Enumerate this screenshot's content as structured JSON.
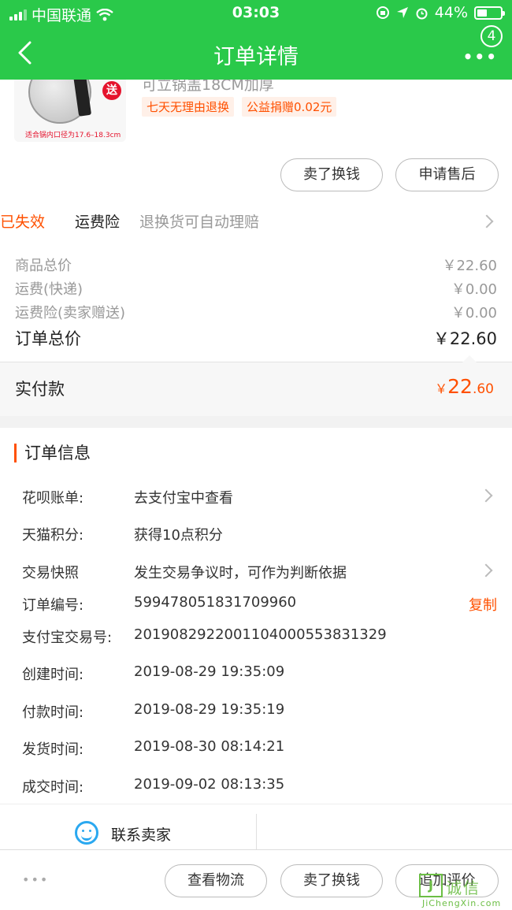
{
  "status_bar": {
    "carrier": "中国联通",
    "time": "03:03",
    "battery": "44%",
    "battery_level": 0.44
  },
  "nav": {
    "title": "订单详情",
    "more_label": "•••",
    "badge": "4"
  },
  "product": {
    "title": "可立锅盖18CM加厚",
    "image_caption": "适合锅内口径为17.6–18.3cm",
    "image_gift": "送",
    "tags": [
      "七天无理由退换",
      "公益捐赠0.02元"
    ],
    "buttons": [
      "卖了换钱",
      "申请售后"
    ]
  },
  "insurance": {
    "label": "运费险",
    "description": "退换货可自动理赔",
    "status": "已失效"
  },
  "summary": {
    "rows": [
      {
        "label": "商品总价",
        "value": "￥22.60"
      },
      {
        "label": "运费(快递)",
        "value": "￥0.00"
      },
      {
        "label": "运费险(卖家赠送)",
        "value": "￥0.00"
      }
    ],
    "total_label": "订单总价",
    "total_value": "￥22.60",
    "paid_label": "实付款",
    "paid_currency": "￥",
    "paid_integer": "22",
    "paid_decimal": ".60"
  },
  "order_info": {
    "heading": "订单信息",
    "rows": [
      {
        "label": "花呗账单:",
        "value": "去支付宝中查看"
      },
      {
        "label": "天猫积分:",
        "value": "获得10点积分"
      },
      {
        "label": "交易快照",
        "value": "发生交易争议时，可作为判断依据"
      },
      {
        "label": "订单编号:",
        "value": "599478051831709960",
        "action": "复制"
      },
      {
        "label": "支付宝交易号:",
        "value": "2019082922001104000553831329"
      },
      {
        "label": "创建时间:",
        "value": "2019-08-29 19:35:09"
      },
      {
        "label": "付款时间:",
        "value": "2019-08-29 19:35:19"
      },
      {
        "label": "发货时间:",
        "value": "2019-08-30 08:14:21"
      },
      {
        "label": "成交时间:",
        "value": "2019-09-02 08:13:35"
      }
    ]
  },
  "contact": {
    "label": "联系卖家"
  },
  "bottom_bar": {
    "more": "•••",
    "buttons": [
      "查看物流",
      "卖了换钱",
      "追加评价"
    ]
  },
  "watermark": {
    "logo": "J",
    "cn": "诚信",
    "en": "JiChengXin.com"
  }
}
